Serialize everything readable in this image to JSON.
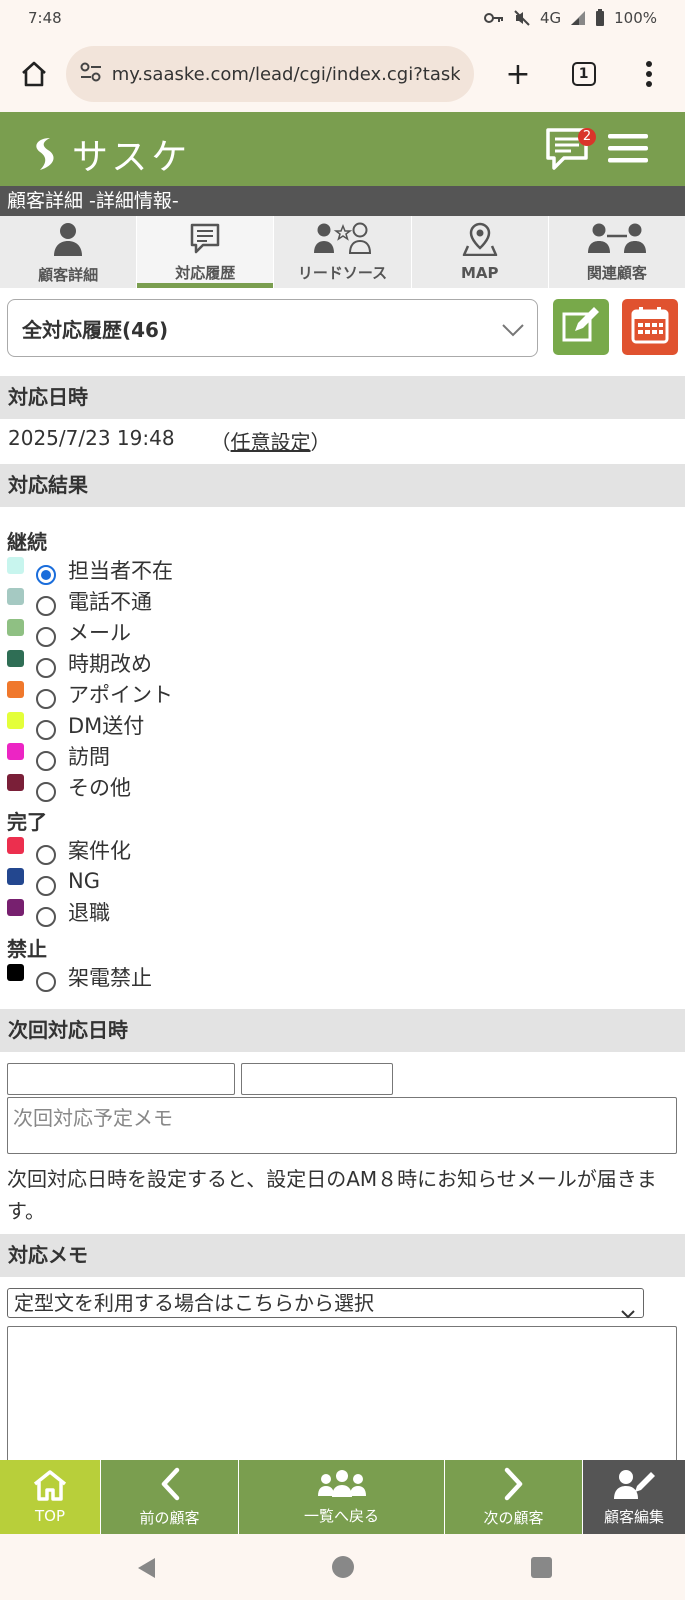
{
  "status_bar": {
    "time": "7:48",
    "network": "4G",
    "battery": "100%"
  },
  "browser": {
    "url": "my.saaske.com/lead/cgi/index.cgi?task=da",
    "tab_count": "1",
    "new_tab": "+"
  },
  "app": {
    "logo_text": "サスケ",
    "notification_count": "2"
  },
  "page_title": "顧客詳細 -詳細情報-",
  "tabs": [
    {
      "label": "顧客詳細",
      "icon": "person-icon"
    },
    {
      "label": "対応履歴",
      "icon": "chat-bubble-icon",
      "active": true
    },
    {
      "label": "リードソース",
      "icon": "people-star-icon"
    },
    {
      "label": "MAP",
      "icon": "map-pin-icon"
    },
    {
      "label": "関連顧客",
      "icon": "related-people-icon"
    }
  ],
  "history_select": {
    "value": "全対応履歴(46)"
  },
  "sections": {
    "datetime": "対応日時",
    "result": "対応結果",
    "next": "次回対応日時",
    "memo": "対応メモ"
  },
  "datetime": {
    "value": "2025/7/23 19:48",
    "open_paren": "（",
    "link": "任意設定",
    "close_paren": "）"
  },
  "result_groups": [
    {
      "label": "継続",
      "options": [
        {
          "label": "担当者不在",
          "color": "#c8f5ee",
          "checked": true
        },
        {
          "label": "電話不通",
          "color": "#a5c9c2"
        },
        {
          "label": "メール",
          "color": "#8fc083"
        },
        {
          "label": "時期改め",
          "color": "#2f6e55"
        },
        {
          "label": "アポイント",
          "color": "#f0782c"
        },
        {
          "label": "DM送付",
          "color": "#e4ff3a"
        },
        {
          "label": "訪問",
          "color": "#ec25c4"
        },
        {
          "label": "その他",
          "color": "#7a1f38"
        }
      ]
    },
    {
      "label": "完了",
      "options": [
        {
          "label": "案件化",
          "color": "#ec2f4e"
        },
        {
          "label": "NG",
          "color": "#23478f"
        },
        {
          "label": "退職",
          "color": "#77206f"
        }
      ]
    },
    {
      "label": "禁止",
      "options": [
        {
          "label": "架電禁止",
          "color": "#000000"
        }
      ]
    }
  ],
  "next": {
    "memo_placeholder": "次回対応予定メモ",
    "note": "次回対応日時を設定すると、設定日のAM８時にお知らせメールが届きます。"
  },
  "memo": {
    "template_select": "定型文を利用する場合はこちらから選択"
  },
  "bottom_nav": [
    {
      "label": "TOP",
      "icon": "home-icon",
      "bg": "#b8cf3a"
    },
    {
      "label": "前の顧客",
      "icon": "chevron-left-icon",
      "bg": "#7a9e4f"
    },
    {
      "label": "一覧へ戻る",
      "icon": "group-icon",
      "bg": "#7a9e4f"
    },
    {
      "label": "次の顧客",
      "icon": "chevron-right-icon",
      "bg": "#7a9e4f"
    },
    {
      "label": "顧客編集",
      "icon": "edit-person-icon",
      "bg": "#555555"
    }
  ],
  "colors": {
    "brand_green": "#7a9e4f",
    "edit_button": "#78a94a",
    "calendar_button": "#e0522f"
  }
}
